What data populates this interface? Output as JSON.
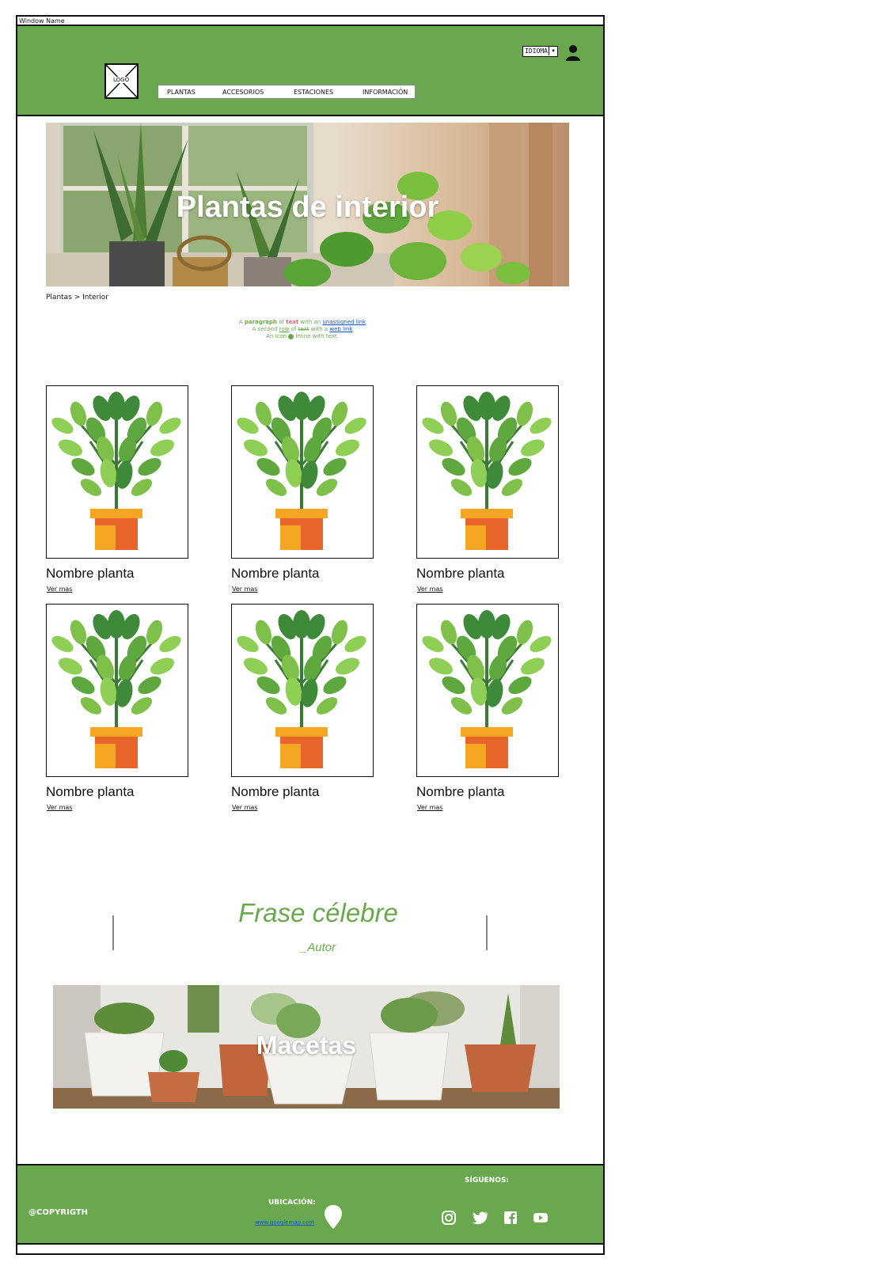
{
  "window": {
    "title": "Window Name"
  },
  "header": {
    "logo_label": "LOGO",
    "language_select": "IDIOMA",
    "nav": [
      "PLANTAS",
      "ACCESORIOS",
      "ESTACIONES",
      "INFORMACIÓN"
    ]
  },
  "hero": {
    "title": "Plantas de interior"
  },
  "breadcrumb": {
    "text": "Plantas > Interior"
  },
  "paragraph": {
    "line1": {
      "a": "A",
      "b": "paragraph",
      "c": "of",
      "d": "text",
      "e": "with an",
      "link": "unassigned link"
    },
    "line2": {
      "a": "A",
      "b": "second",
      "c": "row",
      "d": "of",
      "e": "text",
      "f": "with a",
      "link": "web link"
    },
    "line3": {
      "a": "An icon",
      "b": "inline with text."
    }
  },
  "products": [
    {
      "name": "Nombre planta",
      "link": "Ver mas"
    },
    {
      "name": "Nombre planta",
      "link": "Ver mas"
    },
    {
      "name": "Nombre planta",
      "link": "Ver mas"
    },
    {
      "name": "Nombre planta",
      "link": "Ver mas"
    },
    {
      "name": "Nombre planta",
      "link": "Ver mas"
    },
    {
      "name": "Nombre planta",
      "link": "Ver mas"
    }
  ],
  "quote": {
    "text": "Frase célebre",
    "author": "_Autor"
  },
  "banner": {
    "title": "Macetas"
  },
  "footer": {
    "copyright": "@COPYRIGTH",
    "location_title": "UBICACIÓN:",
    "location_link": "www.googlemap.com",
    "follow": "SÍGUENOS:",
    "social": [
      "instagram-icon",
      "twitter-icon",
      "facebook-icon",
      "youtube-icon"
    ]
  },
  "colors": {
    "brand_green": "#6aa84f",
    "link_blue": "#1155cc"
  }
}
